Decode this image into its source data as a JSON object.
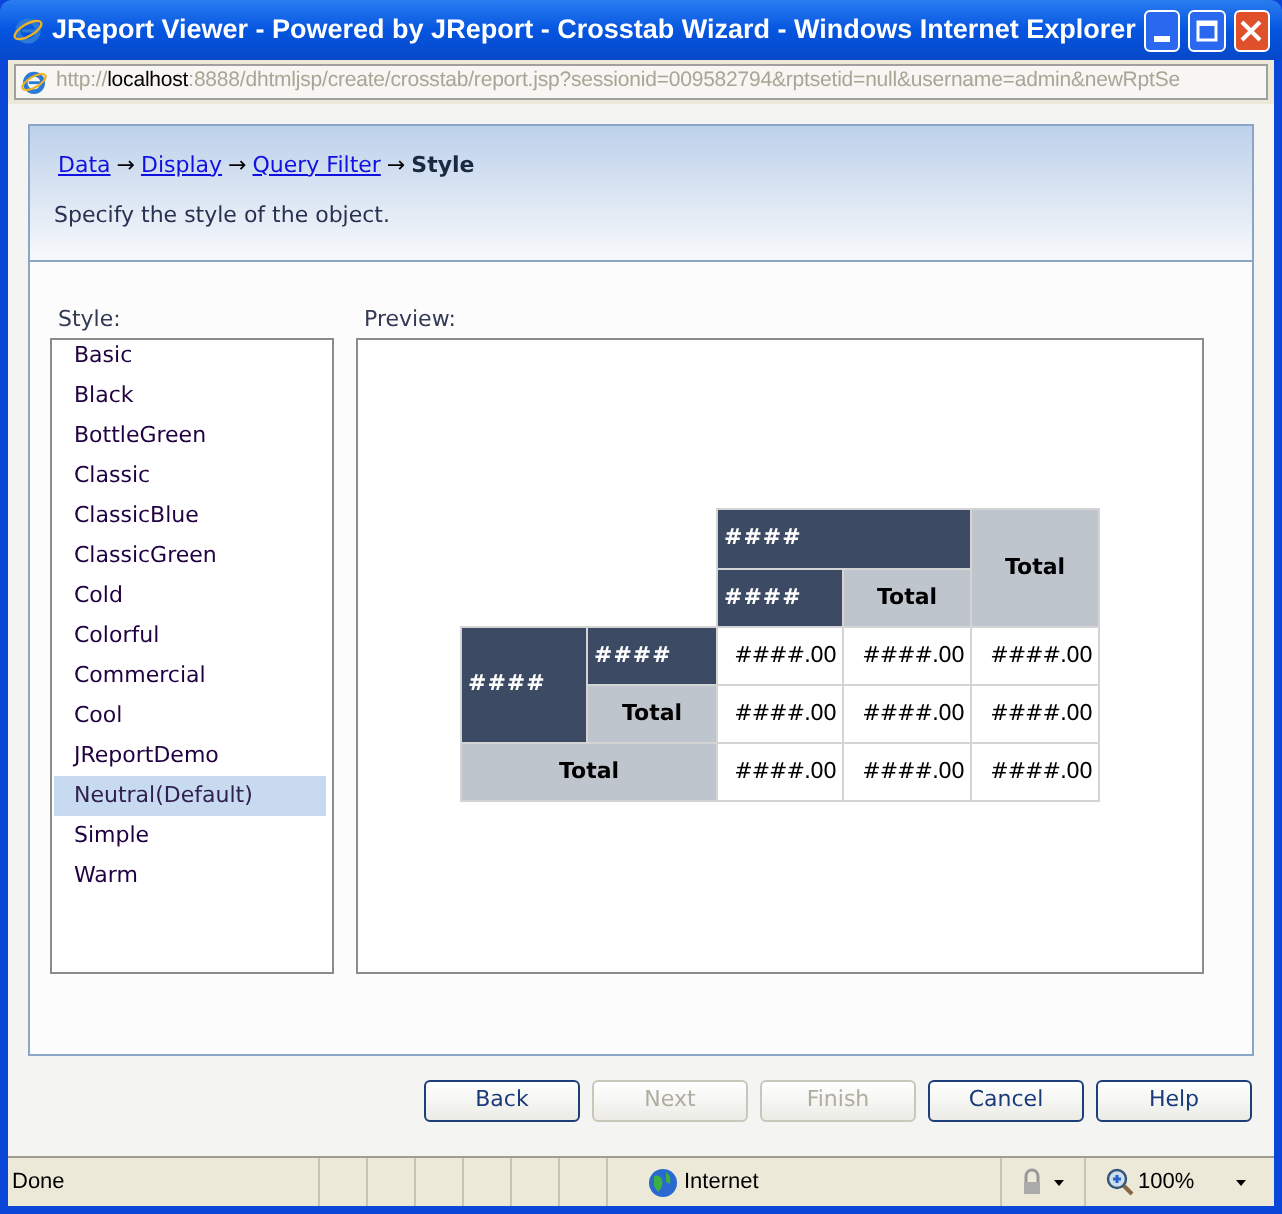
{
  "window": {
    "title": "JReport Viewer - Powered by JReport - Crosstab Wizard - Windows Internet Explorer"
  },
  "address": {
    "scheme": "http://",
    "host": "localhost",
    "rest": ":8888/dhtmljsp/create/crosstab/report.jsp?sessionid=009582794&rptsetid=null&username=admin&newRptSe"
  },
  "breadcrumb": [
    {
      "label": "Data",
      "kind": "link"
    },
    {
      "label": "Display",
      "kind": "link"
    },
    {
      "label": "Query Filter",
      "kind": "link"
    },
    {
      "label": "Style",
      "kind": "current"
    }
  ],
  "separator": "→",
  "description": "Specify the style of the object.",
  "style_label": "Style:",
  "styles": [
    {
      "label": "Basic",
      "selected": false
    },
    {
      "label": "Black",
      "selected": false
    },
    {
      "label": "BottleGreen",
      "selected": false
    },
    {
      "label": "Classic",
      "selected": false
    },
    {
      "label": "ClassicBlue",
      "selected": false
    },
    {
      "label": "ClassicGreen",
      "selected": false
    },
    {
      "label": "Cold",
      "selected": false
    },
    {
      "label": "Colorful",
      "selected": false
    },
    {
      "label": "Commercial",
      "selected": false
    },
    {
      "label": "Cool",
      "selected": false
    },
    {
      "label": "JReportDemo",
      "selected": false
    },
    {
      "label": "Neutral(Default)",
      "selected": true
    },
    {
      "label": "Simple",
      "selected": false
    },
    {
      "label": "Warm",
      "selected": false
    }
  ],
  "preview_label": "Preview:",
  "crosstab": {
    "rows": [
      [
        {
          "kind": "blank",
          "colspan": 2,
          "rowspan": 2
        },
        {
          "kind": "header",
          "text": "####",
          "colspan": 2
        },
        {
          "kind": "total",
          "text": "Total",
          "rowspan": 2
        }
      ],
      [
        {
          "kind": "header",
          "text": "####"
        },
        {
          "kind": "total",
          "text": "Total"
        }
      ],
      [
        {
          "kind": "header",
          "text": "####",
          "rowspan": 2
        },
        {
          "kind": "header",
          "text": "####"
        },
        {
          "kind": "value",
          "text": "####.00"
        },
        {
          "kind": "value",
          "text": "####.00"
        },
        {
          "kind": "value",
          "text": "####.00"
        }
      ],
      [
        {
          "kind": "total",
          "text": "Total"
        },
        {
          "kind": "value",
          "text": "####.00"
        },
        {
          "kind": "value",
          "text": "####.00"
        },
        {
          "kind": "value",
          "text": "####.00"
        }
      ],
      [
        {
          "kind": "total",
          "text": "Total",
          "colspan": 2
        },
        {
          "kind": "value",
          "text": "####.00"
        },
        {
          "kind": "value",
          "text": "####.00"
        },
        {
          "kind": "value",
          "text": "####.00"
        }
      ]
    ]
  },
  "buttons": [
    {
      "label": "Back",
      "disabled": false
    },
    {
      "label": "Next",
      "disabled": true
    },
    {
      "label": "Finish",
      "disabled": true
    },
    {
      "label": "Cancel",
      "disabled": false
    },
    {
      "label": "Help",
      "disabled": false
    }
  ],
  "status_bar": {
    "text": "Done",
    "zone": "Internet",
    "zoom": "100%"
  }
}
